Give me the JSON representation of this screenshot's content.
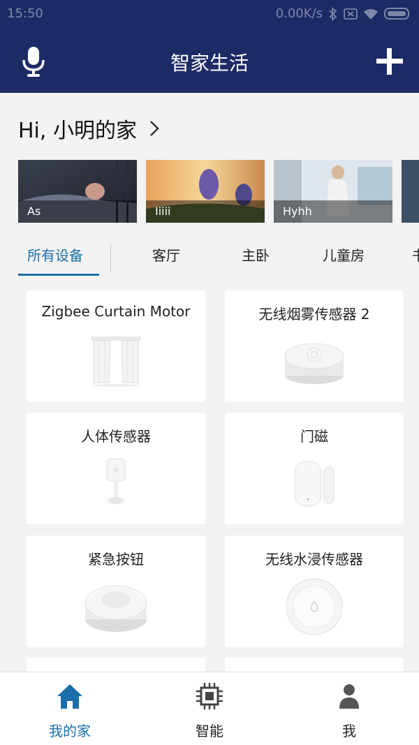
{
  "status_bar": {
    "time": "15:50",
    "speed": "0.00K/s"
  },
  "app_bar": {
    "title": "智家生活"
  },
  "home": {
    "title": "Hi, 小明的家"
  },
  "scenes": [
    {
      "label": "As"
    },
    {
      "label": "Iiiii"
    },
    {
      "label": "Hyhh"
    }
  ],
  "tabs": [
    "所有设备",
    "客厅",
    "主卧",
    "儿童房",
    "书"
  ],
  "devices": [
    {
      "name": "Zigbee Curtain Motor"
    },
    {
      "name": "无线烟雾传感器 2"
    },
    {
      "name": "人体传感器"
    },
    {
      "name": "门磁"
    },
    {
      "name": "紧急按钮"
    },
    {
      "name": "无线水浸传感器"
    }
  ],
  "bottom_nav": [
    {
      "label": "我的家",
      "icon": "home-icon",
      "active": true
    },
    {
      "label": "智能",
      "icon": "chip-icon",
      "active": false
    },
    {
      "label": "我",
      "icon": "person-icon",
      "active": false
    }
  ],
  "colors": {
    "primary": "#1c2b66",
    "accent": "#1a6fa8"
  }
}
